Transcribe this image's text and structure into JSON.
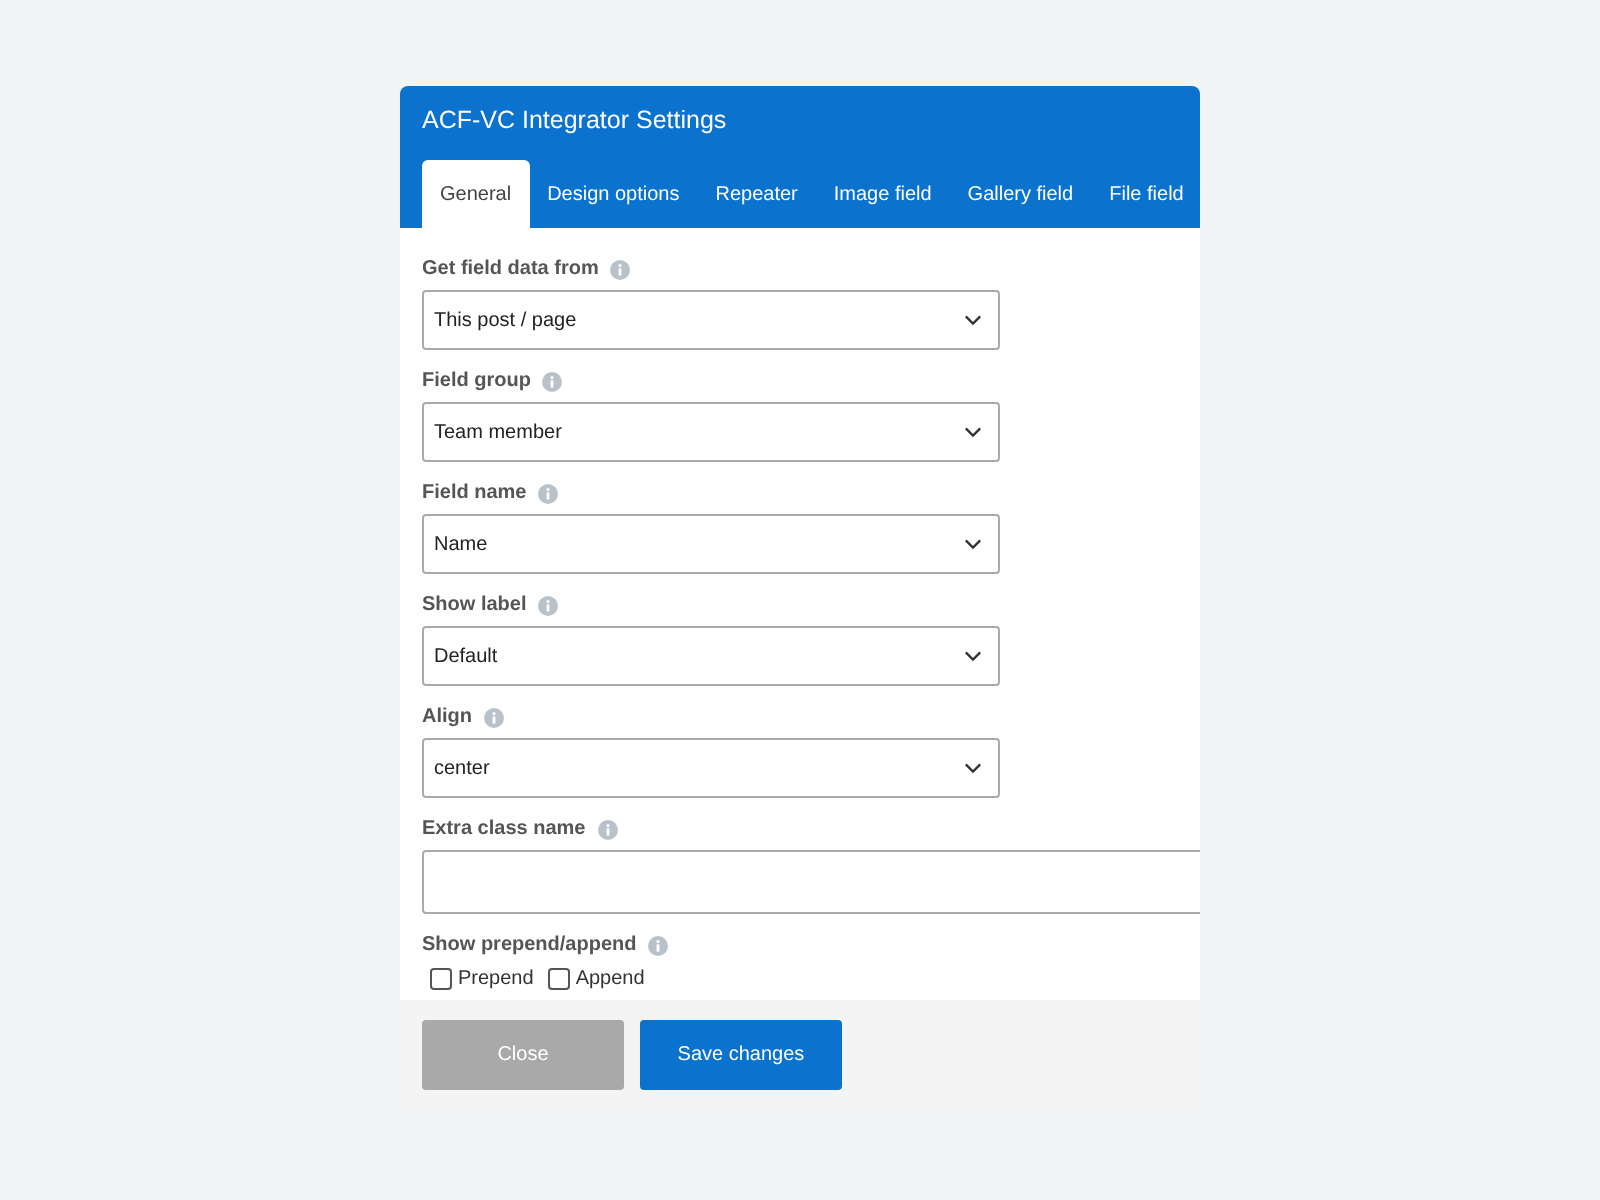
{
  "window": {
    "title": "ACF-VC Integrator Settings"
  },
  "tabs": [
    {
      "label": "General",
      "selected": true
    },
    {
      "label": "Design options",
      "selected": false
    },
    {
      "label": "Repeater",
      "selected": false
    },
    {
      "label": "Image field",
      "selected": false
    },
    {
      "label": "Gallery field",
      "selected": false
    },
    {
      "label": "File field",
      "selected": false
    }
  ],
  "fields": [
    {
      "kind": "select",
      "label": "Get field data from",
      "value": "This post / page"
    },
    {
      "kind": "select",
      "label": "Field group",
      "value": "Team member"
    },
    {
      "kind": "select",
      "label": "Field name",
      "value": "Name"
    },
    {
      "kind": "select",
      "label": "Show label",
      "value": "Default"
    },
    {
      "kind": "select",
      "label": "Align",
      "value": "center"
    },
    {
      "kind": "text",
      "label": "Extra class name"
    },
    {
      "kind": "checks",
      "label": "Show prepend/append",
      "options": [
        {
          "label": "Prepend",
          "checked": false
        },
        {
          "label": "Append",
          "checked": false
        }
      ]
    }
  ],
  "buttons": [
    {
      "label": "Close",
      "disabled": true
    },
    {
      "label": "Save changes",
      "disabled": false
    }
  ]
}
